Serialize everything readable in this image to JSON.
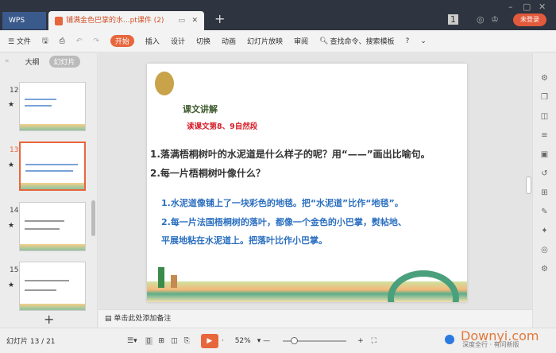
{
  "window": {
    "app_tab": "WPS",
    "doc_tab": "铺满金色巴掌的水...pt课件 (2)",
    "login": "未登录",
    "badge": "1"
  },
  "toolbar": {
    "file": "☰ 文件",
    "items": [
      "开始",
      "插入",
      "设计",
      "切换",
      "动画",
      "幻灯片放映",
      "审阅"
    ],
    "search": "查找命令、搜索模板",
    "help": "?"
  },
  "left": {
    "tab_outline": "大纲",
    "tab_slides": "幻灯片",
    "slides": [
      "12",
      "13",
      "14",
      "15"
    ],
    "active": "13",
    "add": "+"
  },
  "slide": {
    "title": "课文讲解",
    "subtitle": "读课文第8、9自然段",
    "q1": "1.落满梧桐树叶的水泥道是什么样子的呢？用“——”画出比喻句。",
    "q2": "2.每一片梧桐树叶像什么？",
    "a1": "1.水泥道像铺上了一块彩色的地毯。把“水泥道”比作“地毯”。",
    "a2": "2.每一片法国梧桐树的落叶，都像一个金色的小巴掌，熨帖地、",
    "a3": "平展地粘在水泥道上。把落叶比作小巴掌。"
  },
  "notes": {
    "placeholder": "单击此处添加备注"
  },
  "status": {
    "slide_count": "幻灯片 13 / 21",
    "zoom": "52%",
    "watermark": "Downyi.com",
    "watermark_sub": "深度全行 · 有问新版"
  },
  "colors": {
    "accent": "#e8663c",
    "titlebar": "#2e3440"
  }
}
